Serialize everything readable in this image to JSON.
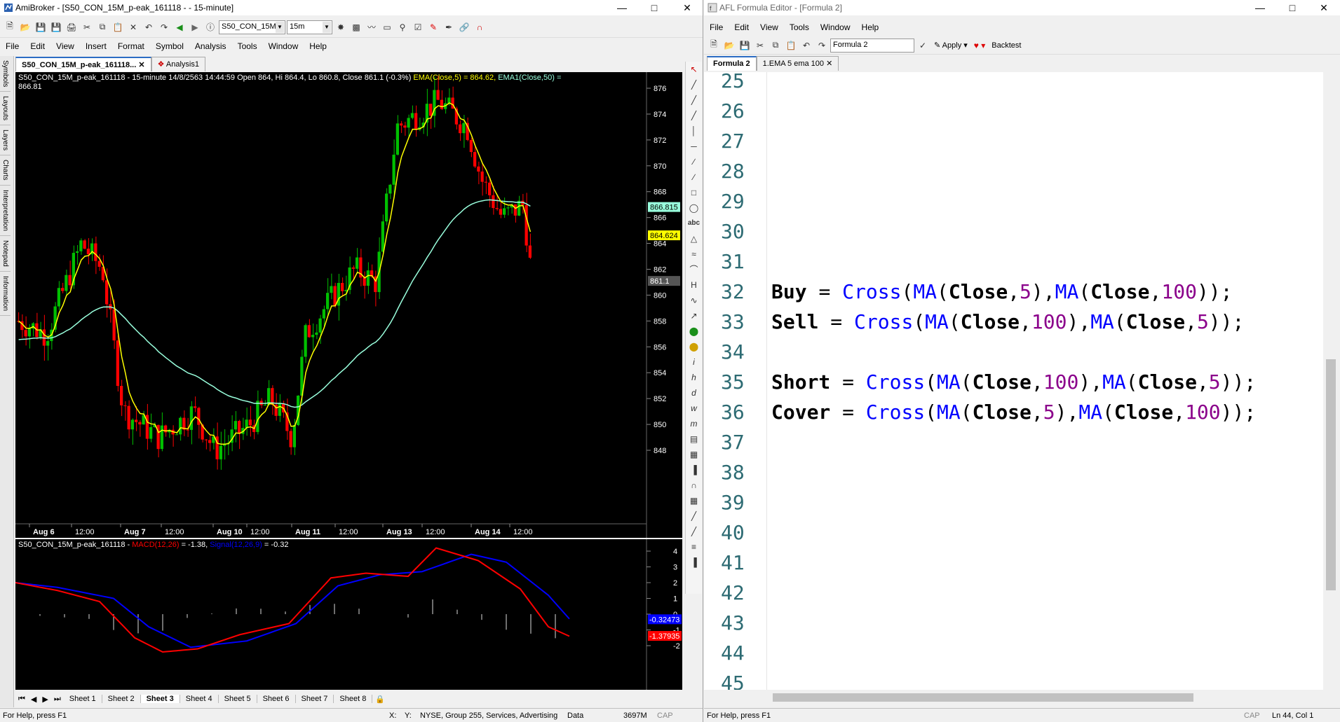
{
  "ami": {
    "title": "AmiBroker - [S50_CON_15M_p-eak_161118 -  - 15-minute]",
    "symbol_combo": "S50_CON_15M_",
    "interval_combo": "15m",
    "menu": [
      "File",
      "Edit",
      "View",
      "Insert",
      "Format",
      "Symbol",
      "Analysis",
      "Tools",
      "Window",
      "Help"
    ],
    "tabs": [
      "S50_CON_15M_p-eak_161118...",
      "Analysis1"
    ],
    "sidebar": [
      "Symbols",
      "Layouts",
      "Layers",
      "Charts",
      "Interpretation",
      "Notepad",
      "Information"
    ],
    "price_header_1": "S50_CON_15M_p-eak_161118 - 15-minute 14/8/2563 14:44:59 Open 864, Hi 864.4, Lo 860.8, Close 861.1 (-0.3%)",
    "price_ema5": "EMA(Close,5) = 864.62,",
    "price_ema50": "EMA1(Close,50) =",
    "price_header_2": "866.81",
    "price_axis": [
      "876",
      "874",
      "872",
      "870",
      "868",
      "866",
      "864",
      "862",
      "860",
      "858",
      "856",
      "854",
      "852",
      "850",
      "848"
    ],
    "price_badges": {
      "ema50": "866.815",
      "ema5": "864.624",
      "close": "861.1"
    },
    "date_axis": [
      "Aug 6",
      "12:00",
      "Aug 7",
      "12:00",
      "Aug 10",
      "12:00",
      "Aug 11",
      "12:00",
      "Aug 13",
      "12:00",
      "Aug 14",
      "12:00"
    ],
    "macd_header_sym": "S50_CON_15M_p-eak_161118 -",
    "macd_label": "MACD(12,26)",
    "macd_value": "= -1.38,",
    "signal_label": "Signal(12,26,9)",
    "signal_value": "= -0.32",
    "macd_axis": [
      "4",
      "3",
      "2",
      "1",
      "0",
      "-1",
      "-2"
    ],
    "macd_badges": {
      "signal": "-0.32473",
      "macd": "-1.37935"
    },
    "sheets": [
      "Sheet 1",
      "Sheet 2",
      "Sheet 3",
      "Sheet 4",
      "Sheet 5",
      "Sheet 6",
      "Sheet 7",
      "Sheet 8"
    ],
    "status": [
      "For Help, press F1",
      "X:",
      "Y:",
      "NYSE, Group 255, Services, Advertising",
      "Data",
      "3697M",
      "CAP"
    ],
    "colors": {
      "bull": "#00c000",
      "bear": "#ff0000",
      "ema5": "#ffff00",
      "ema50": "#99ffdd",
      "macd": "#ff0000",
      "signal": "#0000ff"
    }
  },
  "afl": {
    "title": "AFL Formula Editor - [Formula 2]",
    "menu": [
      "File",
      "Edit",
      "View",
      "Tools",
      "Window",
      "Help"
    ],
    "formula_name": "Formula 2",
    "apply_label": "Apply",
    "backtest_label": "Backtest",
    "tabs": [
      "Formula 2",
      "1.EMA 5 ema 100"
    ],
    "line_numbers": [
      "25",
      "26",
      "27",
      "28",
      "29",
      "30",
      "31",
      "32",
      "33",
      "34",
      "35",
      "36",
      "37",
      "38",
      "39",
      "40",
      "41",
      "42",
      "43",
      "44",
      "45"
    ],
    "status": [
      "For Help, press F1",
      "CAP",
      "Ln 44, Col 1"
    ]
  }
}
